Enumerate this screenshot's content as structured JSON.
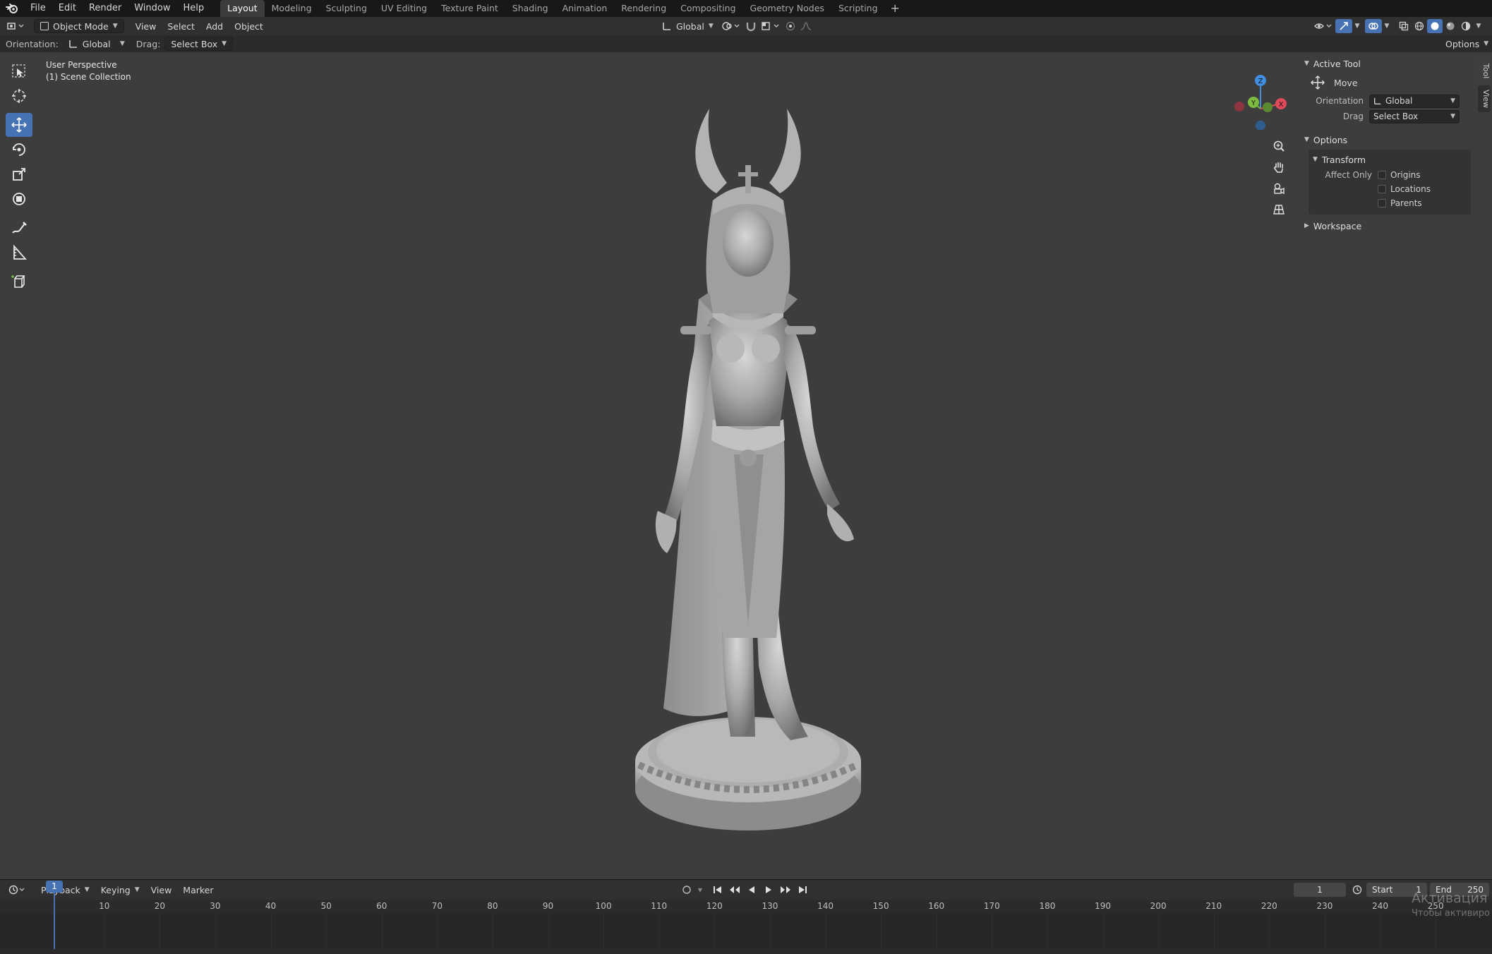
{
  "menubar": {
    "menus": [
      "File",
      "Edit",
      "Render",
      "Window",
      "Help"
    ],
    "workspaces": [
      "Layout",
      "Modeling",
      "Sculpting",
      "UV Editing",
      "Texture Paint",
      "Shading",
      "Animation",
      "Rendering",
      "Compositing",
      "Geometry Nodes",
      "Scripting"
    ],
    "active_workspace": "Layout",
    "add_tab": "+"
  },
  "viewport_header": {
    "mode": "Object Mode",
    "menus": [
      "View",
      "Select",
      "Add",
      "Object"
    ],
    "transform_orientation": "Global",
    "options_label": "Options"
  },
  "tool_settings": {
    "orientation_label": "Orientation:",
    "orientation_value": "Global",
    "drag_label": "Drag:",
    "drag_value": "Select Box"
  },
  "view_info": {
    "perspective": "User Perspective",
    "collection": "(1) Scene Collection"
  },
  "toolbar": {
    "tools": [
      "select-box",
      "cursor",
      "move",
      "rotate",
      "scale",
      "transform",
      "annotate",
      "measure",
      "add-cube"
    ],
    "active_tool": "move"
  },
  "gizmo": {
    "x": "X",
    "y": "Y",
    "z": "Z"
  },
  "npanel": {
    "tabs": [
      "Tool",
      "View"
    ],
    "active_tool_header": "Active Tool",
    "active_tool_name": "Move",
    "orientation_label": "Orientation",
    "orientation_value": "Global",
    "drag_label": "Drag",
    "drag_value": "Select Box",
    "options_header": "Options",
    "transform_header": "Transform",
    "affect_only_label": "Affect Only",
    "affect_only": [
      {
        "label": "Origins",
        "checked": false
      },
      {
        "label": "Locations",
        "checked": false
      },
      {
        "label": "Parents",
        "checked": false
      }
    ],
    "workspace_header": "Workspace"
  },
  "timeline": {
    "menus": [
      "Playback",
      "Keying",
      "View",
      "Marker"
    ],
    "current_frame": "1",
    "start_label": "Start",
    "start_value": "1",
    "end_label": "End",
    "end_value": "250",
    "ticks": [
      "10",
      "20",
      "30",
      "40",
      "50",
      "60",
      "70",
      "80",
      "90",
      "100",
      "110",
      "120",
      "130",
      "140",
      "150",
      "160",
      "170",
      "180",
      "190",
      "200",
      "210",
      "220",
      "230",
      "240",
      "250"
    ],
    "playhead": "1"
  },
  "watermark": {
    "line1": "Активация V",
    "line2": "Чтобы активиро"
  },
  "colors": {
    "accent": "#4772b3",
    "viewport_bg": "#3d3d3d",
    "axis_x": "#e04b5a",
    "axis_y": "#7dbb3f",
    "axis_z": "#3f8ee0"
  }
}
